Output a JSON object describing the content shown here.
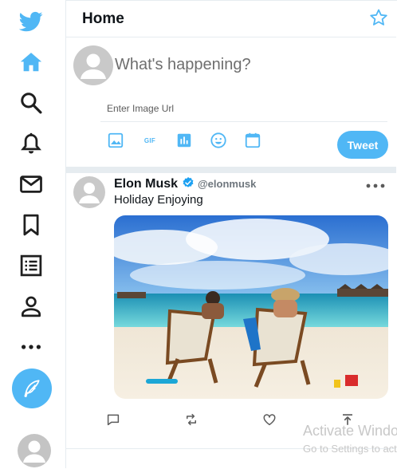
{
  "colors": {
    "accent": "#50b7f5",
    "twitter_blue": "#1da1f2",
    "border": "#e6ecf0",
    "icon_dark": "#1f1f1f"
  },
  "sidebar": {
    "items": [
      {
        "icon": "twitter-logo-icon"
      },
      {
        "icon": "home-icon",
        "active": true
      },
      {
        "icon": "search-icon"
      },
      {
        "icon": "bell-icon"
      },
      {
        "icon": "mail-icon"
      },
      {
        "icon": "bookmark-icon"
      },
      {
        "icon": "list-icon"
      },
      {
        "icon": "profile-icon"
      },
      {
        "icon": "more-icon"
      }
    ],
    "compose_icon": "feather-icon"
  },
  "header": {
    "title": "Home",
    "star_icon": "sparkle-star-icon"
  },
  "composer": {
    "placeholder": "What's happening?",
    "image_url_placeholder": "Enter Image Url",
    "tools": [
      "image-icon",
      "gif-icon",
      "poll-icon",
      "emoji-icon",
      "calendar-icon"
    ],
    "gif_label": "GIF",
    "tweet_label": "Tweet"
  },
  "post": {
    "display_name": "Elon Musk",
    "handle": "@elonmusk",
    "text": "Holiday Enjoying",
    "actions": [
      "reply-icon",
      "retweet-icon",
      "like-icon",
      "share-icon"
    ]
  },
  "watermark": {
    "title": "Activate Windows",
    "subtitle": "Go to Settings to activate Windows."
  }
}
